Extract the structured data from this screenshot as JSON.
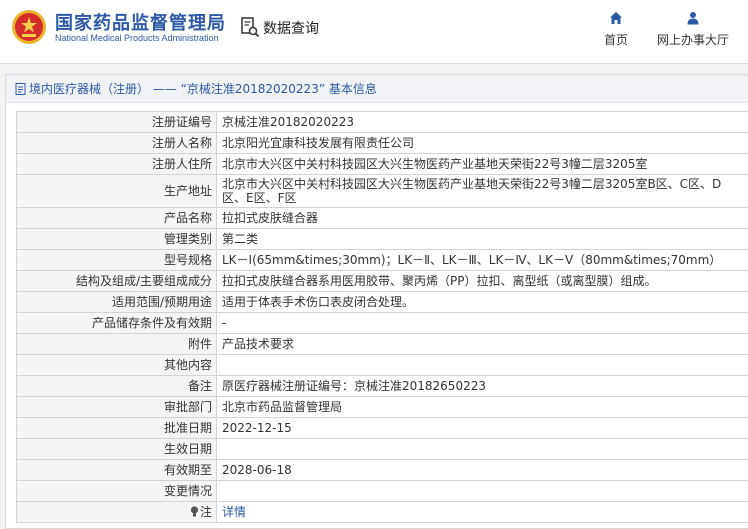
{
  "header": {
    "brand_cn": "国家药品监督管理局",
    "brand_en": "National Medical Products Administration",
    "query_label": "数据查询",
    "nav": [
      {
        "label": "首页",
        "icon": "home-icon"
      },
      {
        "label": "网上办事大厅",
        "icon": "user-icon"
      }
    ]
  },
  "panel": {
    "title": "境内医疗器械（注册） —— “京械注准20182020223” 基本信息"
  },
  "rows": [
    {
      "key": "注册证编号",
      "value": "京械注准20182020223"
    },
    {
      "key": "注册人名称",
      "value": "北京阳光宜康科技发展有限责任公司"
    },
    {
      "key": "注册人住所",
      "value": "北京市大兴区中关村科技园区大兴生物医药产业基地天荣街22号3幢二层3205室"
    },
    {
      "key": "生产地址",
      "value": "北京市大兴区中关村科技园区大兴生物医药产业基地天荣街22号3幢二层3205室B区、C区、D区、E区、F区"
    },
    {
      "key": "产品名称",
      "value": "拉扣式皮肤缝合器"
    },
    {
      "key": "管理类别",
      "value": "第二类"
    },
    {
      "key": "型号规格",
      "value": "LK－Ⅰ(65mm&times;30mm)；LK－Ⅱ、LK－Ⅲ、LK－Ⅳ、LK－Ⅴ（80mm&times;70mm）"
    },
    {
      "key": "结构及组成/主要组成成分",
      "value": "拉扣式皮肤缝合器系用医用胶带、聚丙烯（PP）拉扣、离型纸（或离型膜）组成。"
    },
    {
      "key": "适用范围/预期用途",
      "value": "适用于体表手术伤口表皮闭合处理。"
    },
    {
      "key": "产品储存条件及有效期",
      "value": "-"
    },
    {
      "key": "附件",
      "value": "产品技术要求"
    },
    {
      "key": "其他内容",
      "value": ""
    },
    {
      "key": "备注",
      "value": "原医疗器械注册证编号：京械注准20182650223"
    },
    {
      "key": "审批部门",
      "value": "北京市药品监督管理局"
    },
    {
      "key": "批准日期",
      "value": "2022-12-15"
    },
    {
      "key": "生效日期",
      "value": ""
    },
    {
      "key": "有效期至",
      "value": "2028-06-18"
    },
    {
      "key": "变更情况",
      "value": ""
    }
  ],
  "note": {
    "key": "注",
    "value": "详情"
  },
  "colors": {
    "brand": "#2e59a7",
    "logo_red": "#d62b2b",
    "logo_gold": "#e9b52b"
  }
}
